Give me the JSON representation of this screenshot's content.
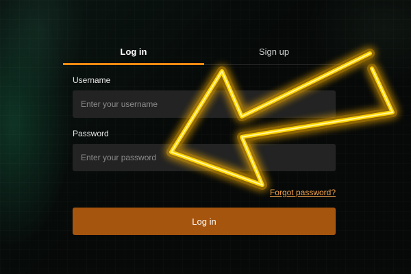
{
  "tabs": {
    "login_label": "Log in",
    "signup_label": "Sign up",
    "active": "Log in"
  },
  "form": {
    "username_label": "Username",
    "username_placeholder": "Enter your username",
    "password_label": "Password",
    "password_placeholder": "Enter your password",
    "forgot_label": "Forgot password?",
    "submit_label": "Log in"
  },
  "overlay": {
    "icon": "arrow-annotation-icon",
    "color": "#ffd400",
    "glow_color": "#ffb300"
  },
  "colors": {
    "accent": "#f08a12",
    "button": "#a6550e",
    "link": "#f3a14b",
    "input_bg": "#222322"
  }
}
